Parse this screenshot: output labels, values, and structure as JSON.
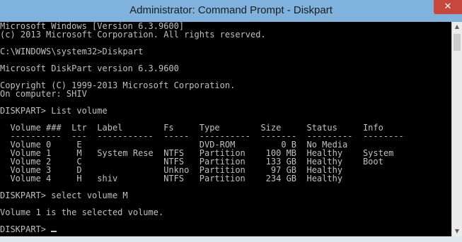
{
  "window": {
    "title": "Administrator: Command Prompt - Diskpart",
    "close_glyph": "✕"
  },
  "console": {
    "text_color": "#c0c0c0",
    "background": "#000000",
    "lines": [
      "Microsoft Windows [Version 6.3.9600]",
      "(c) 2013 Microsoft Corporation. All rights reserved.",
      "",
      "C:\\WINDOWS\\system32>Diskpart",
      "",
      "Microsoft DiskPart version 6.3.9600",
      "",
      "Copyright (C) 1999-2013 Microsoft Corporation.",
      "On computer: SHIV",
      "",
      "DISKPART> List volume",
      "",
      "  Volume ###  Ltr  Label        Fs     Type        Size     Status     Info",
      "  ----------  ---  -----------  -----  ----------  -------  ---------  --------",
      "  Volume 0     E                       DVD-ROM         0 B  No Media",
      "  Volume 1     M   System Rese  NTFS   Partition    100 MB  Healthy    System",
      "  Volume 2     C                NTFS   Partition    133 GB  Healthy    Boot",
      "  Volume 3     D                Unkno  Partition     97 GB  Healthy",
      "  Volume 4     H   shiv         NTFS   Partition    234 GB  Healthy",
      "",
      "DISKPART> select volume M",
      "",
      "Volume 1 is the selected volume.",
      "",
      "DISKPART> "
    ]
  },
  "scrollbar": {
    "up_glyph": "▲",
    "down_glyph": "▼"
  }
}
